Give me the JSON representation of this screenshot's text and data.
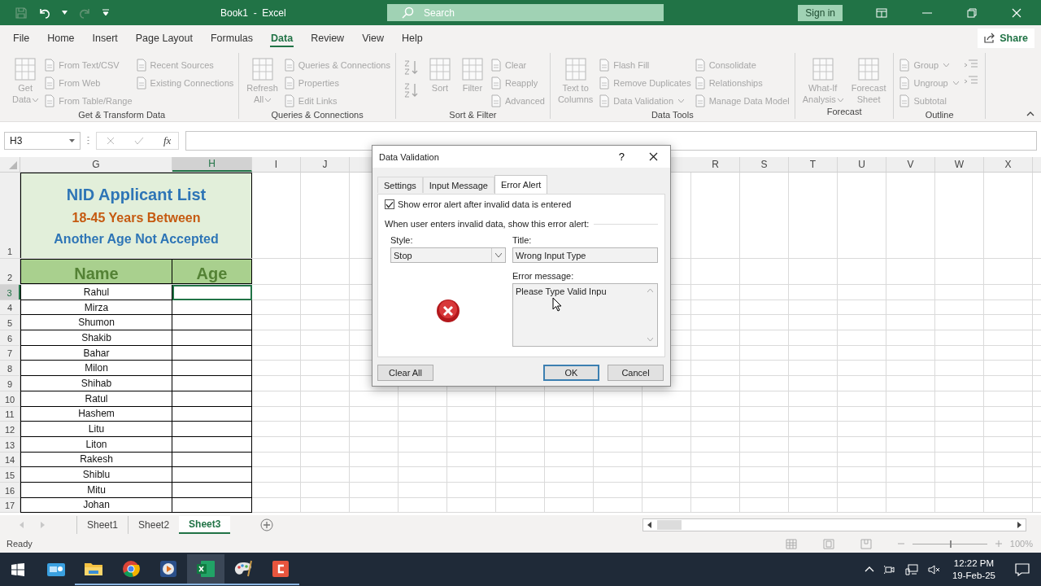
{
  "title_bar": {
    "title": "Book1  -  Excel",
    "search": {
      "placeholder": "Search"
    },
    "sign_in": "Sign in"
  },
  "menu_tabs": [
    {
      "label": "File",
      "selected": false
    },
    {
      "label": "Home",
      "selected": false
    },
    {
      "label": "Insert",
      "selected": false
    },
    {
      "label": "Page Layout",
      "selected": false
    },
    {
      "label": "Formulas",
      "selected": false
    },
    {
      "label": "Data",
      "selected": true
    },
    {
      "label": "Review",
      "selected": false
    },
    {
      "label": "View",
      "selected": false
    },
    {
      "label": "Help",
      "selected": false
    }
  ],
  "share": "Share",
  "ribbon": {
    "disabled": true,
    "groups": [
      {
        "label": "Get & Transform Data",
        "columns": [
          [
            {
              "kind": "large",
              "lines": [
                "Get",
                "Data"
              ],
              "dropdown": true
            }
          ],
          [
            {
              "kind": "small",
              "label": "From Text/CSV"
            },
            {
              "kind": "small",
              "label": "From Web"
            },
            {
              "kind": "small",
              "label": "From Table/Range"
            }
          ],
          [
            {
              "kind": "small",
              "label": "Recent Sources"
            },
            {
              "kind": "small",
              "label": "Existing Connections"
            }
          ]
        ]
      },
      {
        "label": "Queries & Connections",
        "columns": [
          [
            {
              "kind": "large",
              "lines": [
                "Refresh",
                "All"
              ],
              "dropdown": true
            }
          ],
          [
            {
              "kind": "small",
              "label": "Queries & Connections"
            },
            {
              "kind": "small",
              "label": "Properties"
            },
            {
              "kind": "small",
              "label": "Edit Links"
            }
          ]
        ]
      },
      {
        "label": "Sort & Filter",
        "columns": [
          [
            {
              "kind": "sort-asc"
            },
            {
              "kind": "sort-desc"
            }
          ],
          [
            {
              "kind": "large",
              "lines": [
                "Sort"
              ]
            }
          ],
          [
            {
              "kind": "large",
              "lines": [
                "Filter"
              ]
            }
          ],
          [
            {
              "kind": "small",
              "label": "Clear"
            },
            {
              "kind": "small",
              "label": "Reapply"
            },
            {
              "kind": "small",
              "label": "Advanced"
            }
          ]
        ]
      },
      {
        "label": "Data Tools",
        "columns": [
          [
            {
              "kind": "large",
              "lines": [
                "Text to",
                "Columns"
              ]
            }
          ],
          [
            {
              "kind": "small",
              "label": "Flash Fill"
            },
            {
              "kind": "small",
              "label": "Remove Duplicates"
            },
            {
              "kind": "small",
              "label": "Data Validation",
              "dropdown": true
            }
          ],
          [
            {
              "kind": "small",
              "label": "Consolidate"
            },
            {
              "kind": "small",
              "label": "Relationships"
            },
            {
              "kind": "small",
              "label": "Manage Data Model"
            }
          ]
        ]
      },
      {
        "label": "Forecast",
        "columns": [
          [
            {
              "kind": "large",
              "lines": [
                "What-If",
                "Analysis"
              ],
              "dropdown": true
            }
          ],
          [
            {
              "kind": "large",
              "lines": [
                "Forecast",
                "Sheet"
              ]
            }
          ]
        ]
      },
      {
        "label": "Outline",
        "columns": [
          [
            {
              "kind": "small",
              "label": "Group",
              "dropdown": true
            },
            {
              "kind": "small",
              "label": "Ungroup",
              "dropdown": true
            },
            {
              "kind": "small",
              "label": "Subtotal"
            }
          ],
          [
            {
              "kind": "show-detail"
            },
            {
              "kind": "hide-detail"
            }
          ]
        ]
      }
    ]
  },
  "formula_bar": {
    "name_box": "H3",
    "function_label": "fx"
  },
  "sheet": {
    "columns_left": [
      {
        "label": "G",
        "selected": false
      },
      {
        "label": "H",
        "selected": true
      },
      {
        "label": "I",
        "selected": false
      },
      {
        "label": "J",
        "selected": false
      }
    ],
    "columns_right": [
      {
        "label": "R",
        "selected": false
      },
      {
        "label": "S",
        "selected": false
      },
      {
        "label": "T",
        "selected": false
      },
      {
        "label": "U",
        "selected": false
      },
      {
        "label": "V",
        "selected": false
      },
      {
        "label": "W",
        "selected": false
      },
      {
        "label": "X",
        "selected": false
      }
    ],
    "title_row": {
      "number": "1",
      "lines": [
        {
          "text": "NID Applicant List",
          "color": "#2e75b6"
        },
        {
          "text": "18-45 Years Between",
          "color": "#c55a11"
        },
        {
          "text": "Another Age Not Accepted",
          "color": "#2e75b6"
        }
      ]
    },
    "header_row": {
      "number": "2",
      "cells": [
        "Name",
        "Age"
      ]
    },
    "rows": [
      {
        "number": "3",
        "name": "Rahul",
        "selected": true
      },
      {
        "number": "4",
        "name": "Mirza",
        "selected": false
      },
      {
        "number": "5",
        "name": "Shumon",
        "selected": false
      },
      {
        "number": "6",
        "name": "Shakib",
        "selected": false
      },
      {
        "number": "7",
        "name": "Bahar",
        "selected": false
      },
      {
        "number": "8",
        "name": "Milon",
        "selected": false
      },
      {
        "number": "9",
        "name": "Shihab",
        "selected": false
      },
      {
        "number": "10",
        "name": "Ratul",
        "selected": false
      },
      {
        "number": "11",
        "name": "Hashem",
        "selected": false
      },
      {
        "number": "12",
        "name": "Litu",
        "selected": false
      },
      {
        "number": "13",
        "name": "Liton",
        "selected": false
      },
      {
        "number": "14",
        "name": "Rakesh",
        "selected": false
      },
      {
        "number": "15",
        "name": "Shiblu",
        "selected": false
      },
      {
        "number": "16",
        "name": "Mitu",
        "selected": false
      },
      {
        "number": "17",
        "name": "Johan",
        "selected": false
      }
    ]
  },
  "dialog": {
    "title": "Data Validation",
    "help": "?",
    "tabs": [
      {
        "label": "Settings",
        "selected": false
      },
      {
        "label": "Input Message",
        "selected": false
      },
      {
        "label": "Error Alert",
        "selected": true
      }
    ],
    "show_alert": {
      "label": "Show error alert after invalid data is entered",
      "checked": true
    },
    "section": "When user enters invalid data, show this error alert:",
    "style": {
      "label": "Style:",
      "value": "Stop"
    },
    "title_field": {
      "label": "Title:",
      "value": "Wrong Input Type"
    },
    "message": {
      "label": "Error message:",
      "value": "Please Type Valid Inpu"
    },
    "buttons": [
      {
        "label": "Clear All",
        "default": false
      },
      {
        "label": "OK",
        "default": true
      },
      {
        "label": "Cancel",
        "default": false
      }
    ]
  },
  "sheet_tabs": [
    {
      "label": "Sheet1",
      "selected": false
    },
    {
      "label": "Sheet2",
      "selected": false
    },
    {
      "label": "Sheet3",
      "selected": true
    }
  ],
  "status_bar": {
    "status": "Ready",
    "zoom": {
      "level": 0.5,
      "reading": "100%"
    }
  },
  "taskbar": {
    "apps": [
      {
        "kind": "news",
        "running": false,
        "active": false
      },
      {
        "kind": "folder",
        "running": true,
        "active": false
      },
      {
        "kind": "browser",
        "running": true,
        "active": false
      },
      {
        "kind": "media",
        "running": true,
        "active": false
      },
      {
        "kind": "spreadsheet",
        "running": true,
        "active": true
      },
      {
        "kind": "paint",
        "running": true,
        "active": false
      },
      {
        "kind": "recorder",
        "running": true,
        "active": false
      }
    ],
    "clock": {
      "time": "12:22 PM",
      "date": "19-Feb-25"
    }
  }
}
